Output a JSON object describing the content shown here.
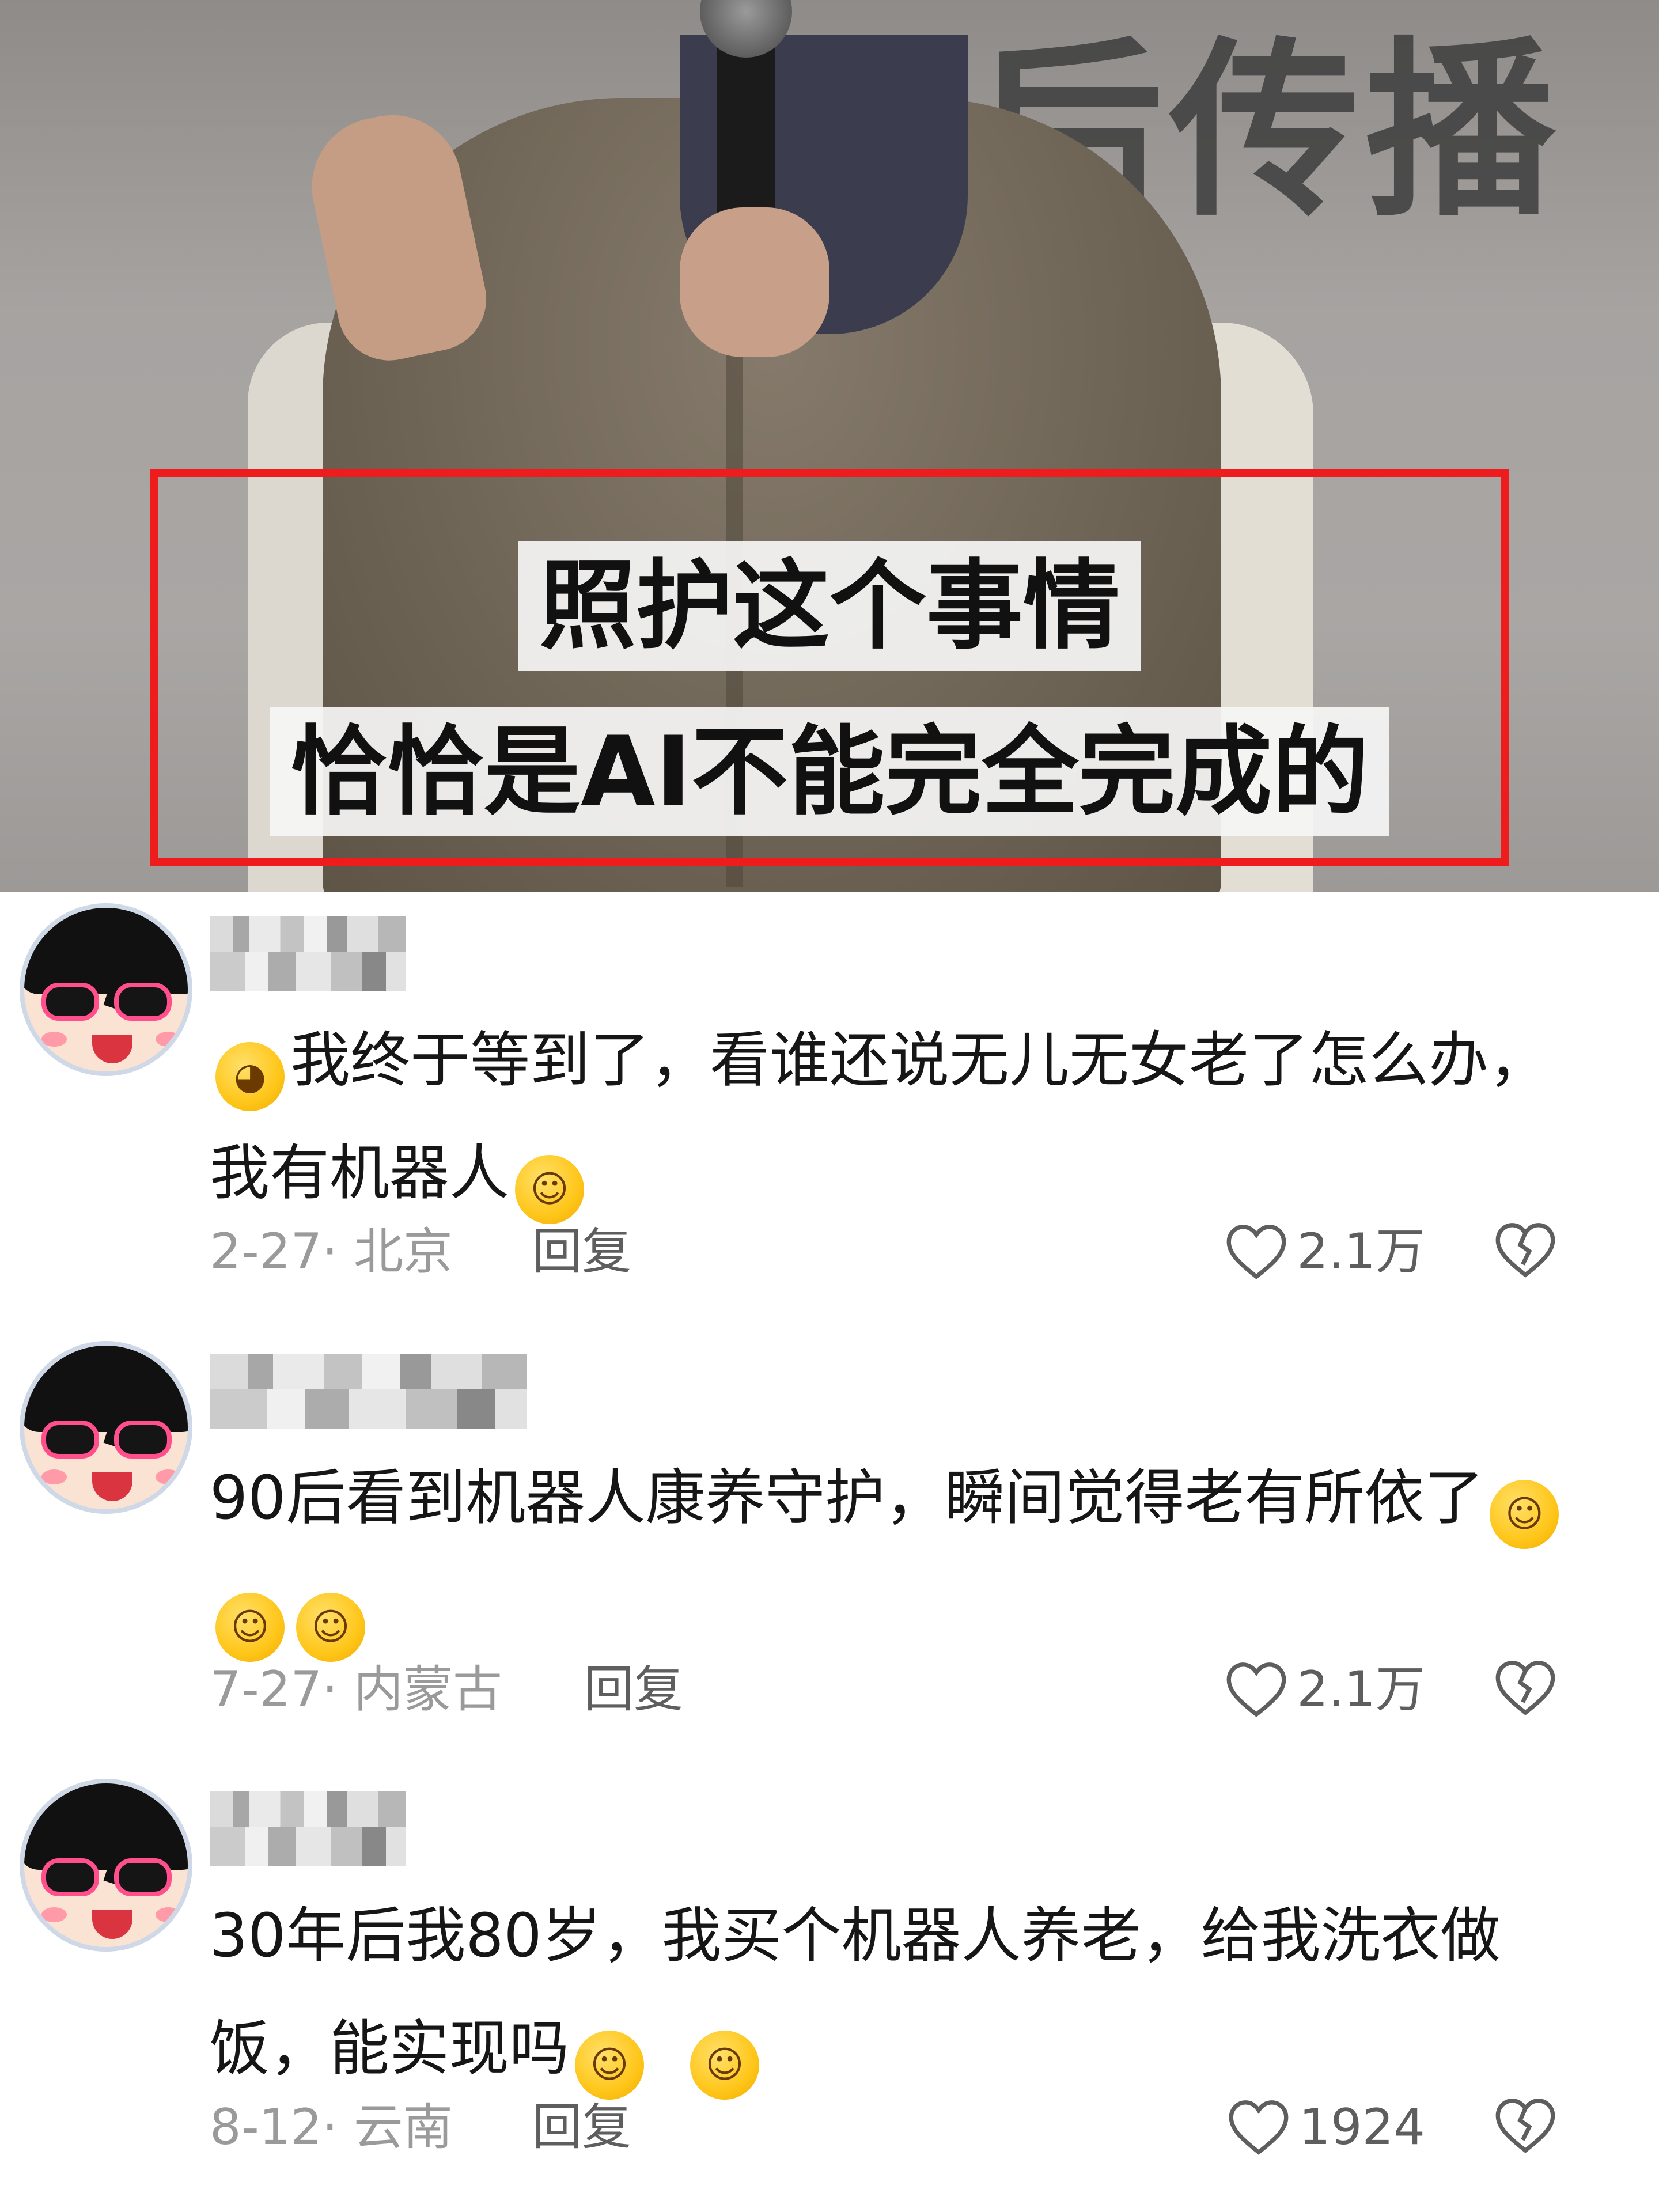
{
  "video": {
    "stage_text": "后传播",
    "caption_line1": "照护这个事情",
    "caption_line2": "恰恰是AI不能完全完成的"
  },
  "comments": [
    {
      "text": "我终于等到了，看谁还说无儿无女老了怎么办，我有机器人",
      "lead_emoji": "loudly-crying-face",
      "trail_emoji": [
        "rolling-laughing-face"
      ],
      "date_location": "2-27· 北京",
      "reply_label": "回复",
      "like_count": "2.1万"
    },
    {
      "text": "90后看到机器人康养守护，瞬间觉得老有所依了",
      "lead_emoji": "",
      "trail_emoji": [
        "hand-over-mouth-face",
        "hand-over-mouth-face",
        "hand-over-mouth-face"
      ],
      "date_location": "7-27· 内蒙古",
      "reply_label": "回复",
      "like_count": "2.1万"
    },
    {
      "text": "30年后我80岁，我买个机器人养老，给我洗衣做饭，能实现吗",
      "lead_emoji": "",
      "trail_emoji": [
        "grinning-face",
        "grinning-face"
      ],
      "date_location": "8-12· 云南",
      "reply_label": "回复",
      "like_count": "1924"
    }
  ],
  "colors": {
    "highlight_border": "#ee1c1c",
    "meta_gray": "#9a9a9a",
    "text": "#161616"
  }
}
